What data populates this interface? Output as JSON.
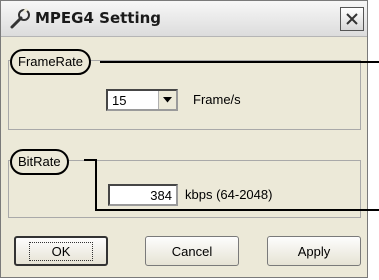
{
  "window": {
    "title": "MPEG4 Setting",
    "close_glyph": "✕"
  },
  "framerate": {
    "group_label": "FrameRate",
    "selected_value": "15",
    "unit": "Frame/s"
  },
  "bitrate": {
    "group_label": "BitRate",
    "value": "384",
    "unit": "kbps (64-2048)"
  },
  "buttons": {
    "ok": "OK",
    "cancel": "Cancel",
    "apply": "Apply"
  },
  "icons": {
    "title": "wrench-icon",
    "close": "close-icon",
    "dropdown": "chevron-down-icon"
  }
}
